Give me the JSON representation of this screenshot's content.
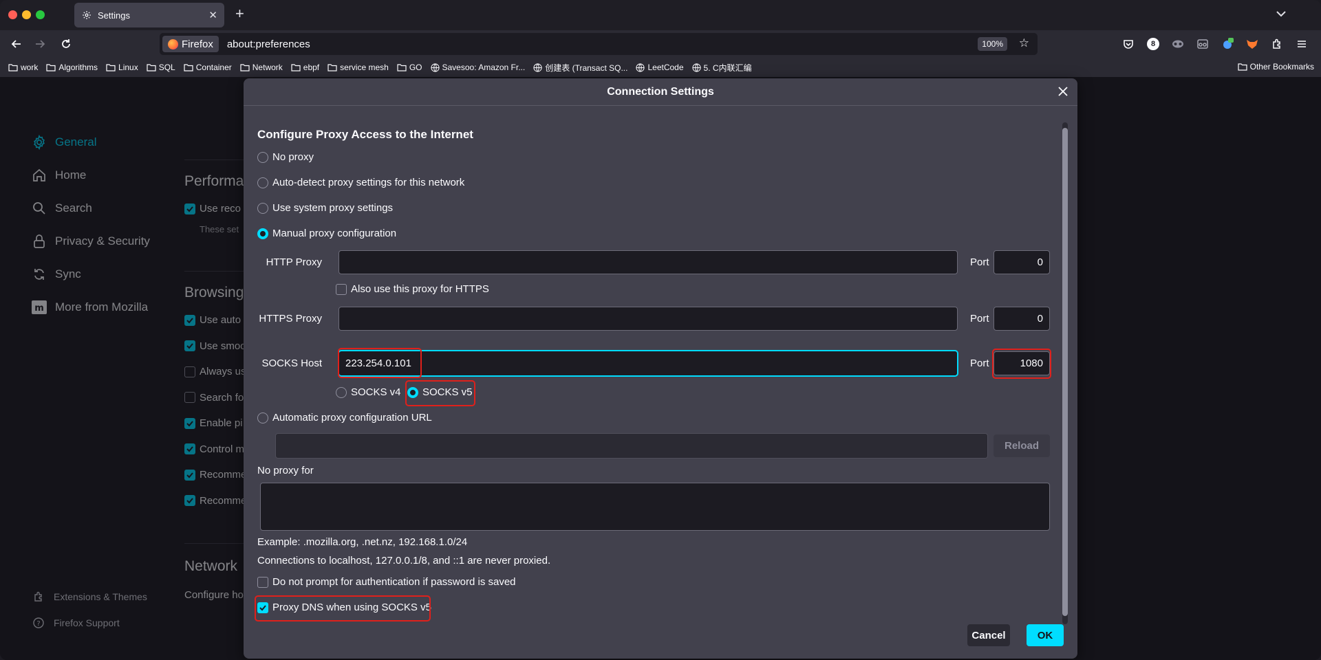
{
  "browser": {
    "tab_title": "Settings",
    "identity_label": "Firefox",
    "url": "about:preferences",
    "zoom": "100%",
    "toolbar_badge": "8",
    "traffic_colors": [
      "#ff5f57",
      "#febc2e",
      "#28c840"
    ]
  },
  "bookmarks": [
    {
      "label": "work",
      "icon": "folder-icon"
    },
    {
      "label": "Algorithms",
      "icon": "folder-icon"
    },
    {
      "label": "Linux",
      "icon": "folder-icon"
    },
    {
      "label": "SQL",
      "icon": "folder-icon"
    },
    {
      "label": "Container",
      "icon": "folder-icon"
    },
    {
      "label": "Network",
      "icon": "folder-icon"
    },
    {
      "label": "ebpf",
      "icon": "folder-icon"
    },
    {
      "label": "service mesh",
      "icon": "folder-icon"
    },
    {
      "label": "GO",
      "icon": "folder-icon"
    },
    {
      "label": "Savesoo: Amazon Fr...",
      "icon": "globe-icon"
    },
    {
      "label": "创建表 (Transact SQ...",
      "icon": "globe-icon"
    },
    {
      "label": "LeetCode",
      "icon": "globe-icon"
    },
    {
      "label": "5. C内联汇编",
      "icon": "globe-icon"
    }
  ],
  "other_bookmarks": "Other Bookmarks",
  "sidebar": {
    "items": [
      {
        "label": "General",
        "icon": "gear-icon",
        "active": true
      },
      {
        "label": "Home",
        "icon": "home-icon"
      },
      {
        "label": "Search",
        "icon": "search-icon"
      },
      {
        "label": "Privacy & Security",
        "icon": "lock-icon"
      },
      {
        "label": "Sync",
        "icon": "sync-icon"
      },
      {
        "label": "More from Mozilla",
        "icon": "mozilla-icon"
      }
    ],
    "footer": [
      {
        "label": "Extensions & Themes",
        "icon": "puzzle-icon"
      },
      {
        "label": "Firefox Support",
        "icon": "help-icon"
      }
    ]
  },
  "background": {
    "performance_heading": "Performa",
    "use_recommended": "Use reco",
    "these_settings": "These set",
    "browsing_heading": "Browsing",
    "browsing_options": [
      "Use auto",
      "Use smoo",
      "Always us",
      "Search fo",
      "Enable pi",
      "Control m",
      "Recomme",
      "Recomme"
    ],
    "network_heading": "Network",
    "network_desc": "Configure ho"
  },
  "dialog": {
    "title": "Connection Settings",
    "section_heading": "Configure Proxy Access to the Internet",
    "options": {
      "no_proxy": "No proxy",
      "auto_detect": "Auto-detect proxy settings for this network",
      "system": "Use system proxy settings",
      "manual": "Manual proxy configuration",
      "auto_url": "Automatic proxy configuration URL"
    },
    "selected_option": "manual",
    "http_proxy": {
      "label": "HTTP Proxy",
      "value": "",
      "port_label": "Port",
      "port": "0"
    },
    "also_https": "Also use this proxy for HTTPS",
    "https_proxy": {
      "label": "HTTPS Proxy",
      "value": "",
      "port_label": "Port",
      "port": "0"
    },
    "socks": {
      "label": "SOCKS Host",
      "value": "223.254.0.101",
      "port_label": "Port",
      "port": "1080",
      "v4": "SOCKS v4",
      "v5": "SOCKS v5",
      "version": "v5"
    },
    "auto_url_value": "",
    "reload_label": "Reload",
    "no_proxy_label": "No proxy for",
    "no_proxy_value": "",
    "example": "Example: .mozilla.org, .net.nz, 192.168.1.0/24",
    "localhost_note": "Connections to localhost, 127.0.0.1/8, and ::1 are never proxied.",
    "no_prompt_auth": "Do not prompt for authentication if password is saved",
    "proxy_dns": "Proxy DNS when using SOCKS v5",
    "proxy_dns_checked": true,
    "cancel_label": "Cancel",
    "ok_label": "OK"
  },
  "colors": {
    "accent": "#00ddff",
    "highlight": "#e0201b"
  }
}
